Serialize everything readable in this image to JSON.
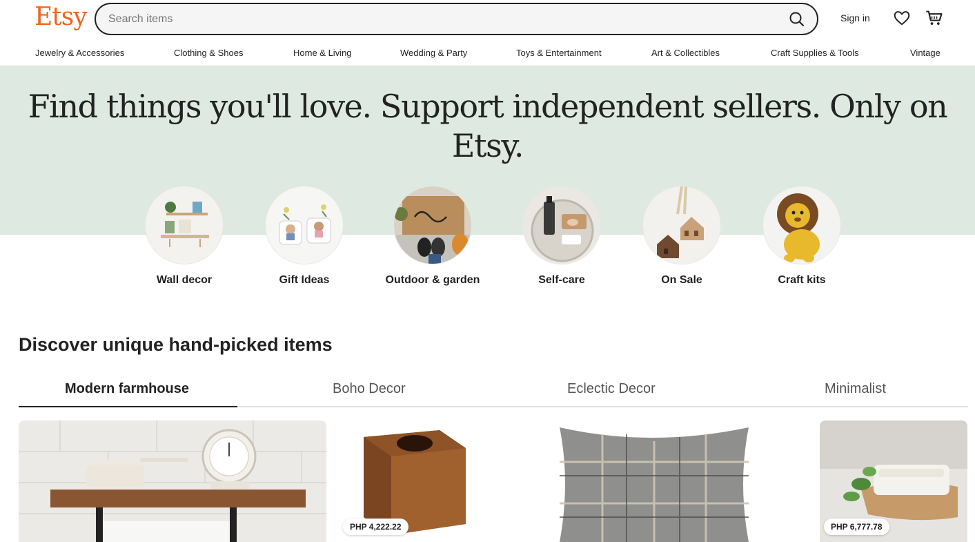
{
  "header": {
    "logo": "Etsy",
    "search_placeholder": "Search items",
    "signin_label": "Sign in",
    "icons": [
      "search-icon",
      "heart-icon",
      "cart-icon"
    ],
    "brand_color": "#F1641E"
  },
  "nav": {
    "items": [
      "Jewelry & Accessories",
      "Clothing & Shoes",
      "Home & Living",
      "Wedding & Party",
      "Toys & Entertainment",
      "Art & Collectibles",
      "Craft Supplies & Tools",
      "Vintage"
    ]
  },
  "hero": {
    "title": "Find things you'll love. Support independent sellers. Only on Etsy.",
    "background": "#dde9e1",
    "categories": [
      {
        "label": "Wall decor"
      },
      {
        "label": "Gift Ideas"
      },
      {
        "label": "Outdoor & garden"
      },
      {
        "label": "Self-care"
      },
      {
        "label": "On Sale"
      },
      {
        "label": "Craft kits"
      }
    ]
  },
  "discover": {
    "title": "Discover unique hand-picked items",
    "tabs": [
      "Modern farmhouse",
      "Boho Decor",
      "Eclectic Decor",
      "Minimalist"
    ],
    "active_tab": "Modern farmhouse",
    "cards": [
      {
        "name": "Wall shelf with pot and scale",
        "price": ""
      },
      {
        "name": "Wooden tissue box cover",
        "price": "PHP 4,222.22"
      },
      {
        "name": "Plaid throw pillow",
        "price": ""
      },
      {
        "name": "Ceramic dish on cutting board",
        "price": "PHP 6,777.78"
      }
    ]
  }
}
